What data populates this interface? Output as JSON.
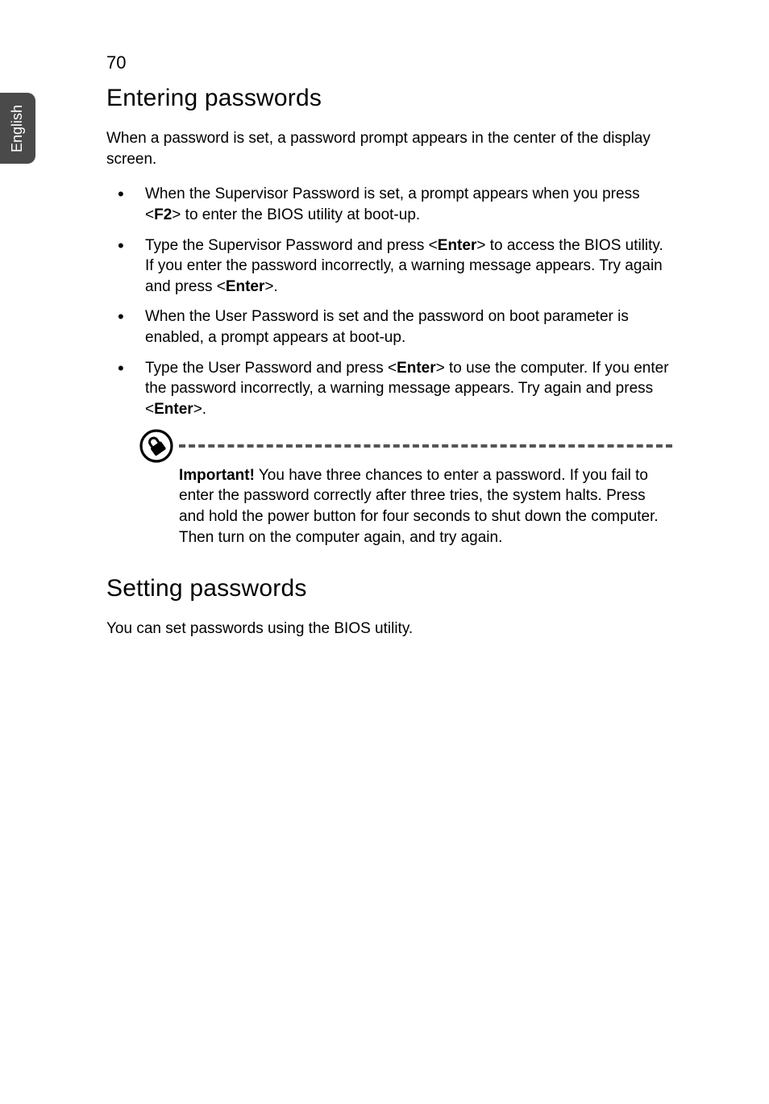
{
  "sideTab": "English",
  "pageNumber": "70",
  "section1": {
    "title": "Entering passwords",
    "intro": "When a password is set, a password prompt appears in the center of the display screen.",
    "bullets": [
      {
        "pre": "When the Supervisor Password is set, a prompt appears when you press <",
        "key1": "F2",
        "post": "> to enter the BIOS utility at boot-up."
      },
      {
        "pre": "Type the Supervisor Password and press <",
        "key1": "Enter",
        "mid": "> to access the BIOS utility. If you enter the password incorrectly, a warning message appears. Try again and press <",
        "key2": "Enter",
        "post": ">."
      },
      {
        "pre": "When the User Password is set and the password on boot parameter is enabled, a prompt appears at boot-up."
      },
      {
        "pre": "Type the User Password and press <",
        "key1": "Enter",
        "mid": "> to use the computer. If you enter the password incorrectly, a warning message appears. Try again and press <",
        "key2": "Enter",
        "post": ">."
      }
    ],
    "important": {
      "label": "Important!",
      "text": " You have three chances to enter a password. If you fail to enter the password correctly after three tries, the system halts. Press and hold the power button for four seconds to shut down the computer. Then turn on the computer again, and try again."
    }
  },
  "section2": {
    "title": "Setting passwords",
    "intro": "You can set passwords using the BIOS utility."
  }
}
